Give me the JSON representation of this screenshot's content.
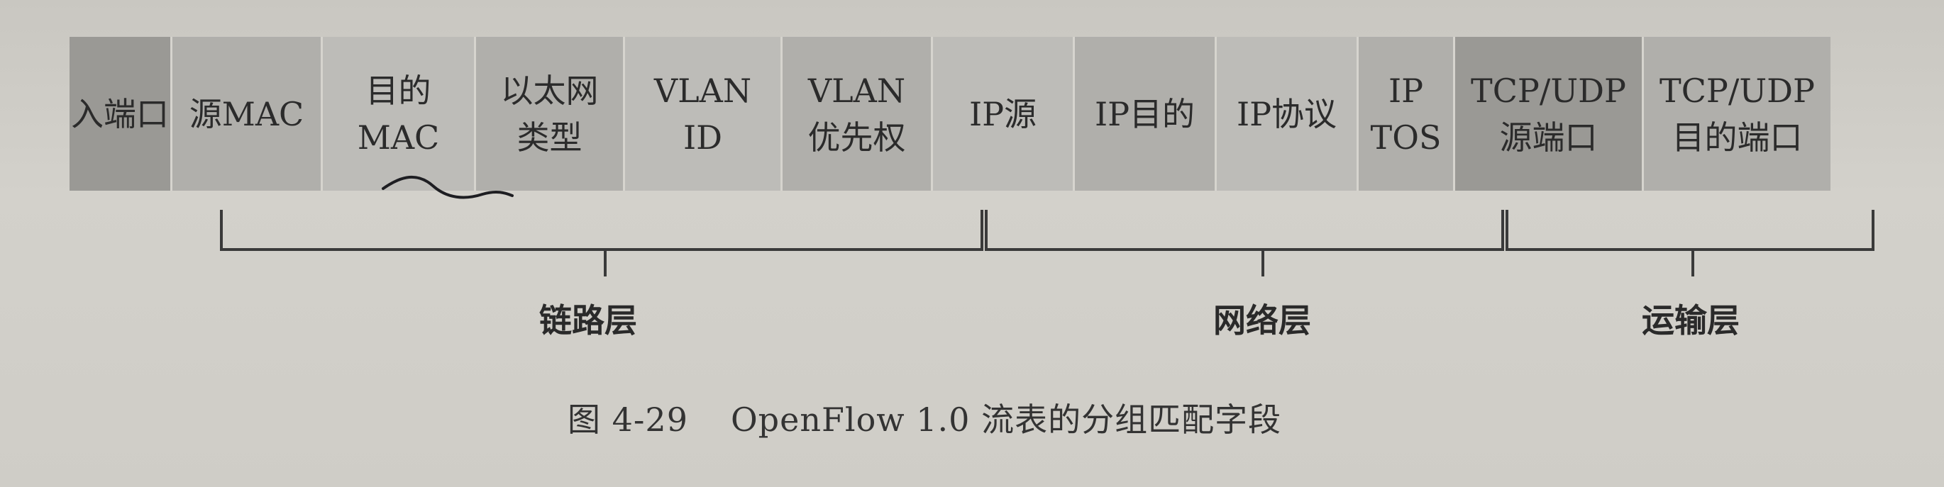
{
  "fields": [
    {
      "lines": [
        "入端口"
      ],
      "shade": "dark"
    },
    {
      "lines": [
        "源MAC"
      ],
      "shade": "mid"
    },
    {
      "lines": [
        "目的",
        "MAC"
      ],
      "shade": "light"
    },
    {
      "lines": [
        "以太网",
        "类型"
      ],
      "shade": "mid"
    },
    {
      "lines": [
        "VLAN",
        "ID"
      ],
      "shade": "light"
    },
    {
      "lines": [
        "VLAN",
        "优先权"
      ],
      "shade": "mid"
    },
    {
      "lines": [
        "IP源"
      ],
      "shade": "light"
    },
    {
      "lines": [
        "IP目的"
      ],
      "shade": "mid"
    },
    {
      "lines": [
        "IP协议"
      ],
      "shade": "light"
    },
    {
      "lines": [
        "IP",
        "TOS"
      ],
      "shade": "mid"
    },
    {
      "lines": [
        "TCP/UDP",
        "源端口"
      ],
      "shade": "dark"
    },
    {
      "lines": [
        "TCP/UDP",
        "目的端口"
      ],
      "shade": "mid"
    }
  ],
  "layers": [
    {
      "label": "链路层"
    },
    {
      "label": "网络层"
    },
    {
      "label": "运输层"
    }
  ],
  "caption": {
    "number": "图 4-29",
    "text": "OpenFlow 1.0 流表的分组匹配字段"
  },
  "colors": {
    "bracket": "#3a3a3a",
    "handwritten_mark": "#1e1e22"
  }
}
